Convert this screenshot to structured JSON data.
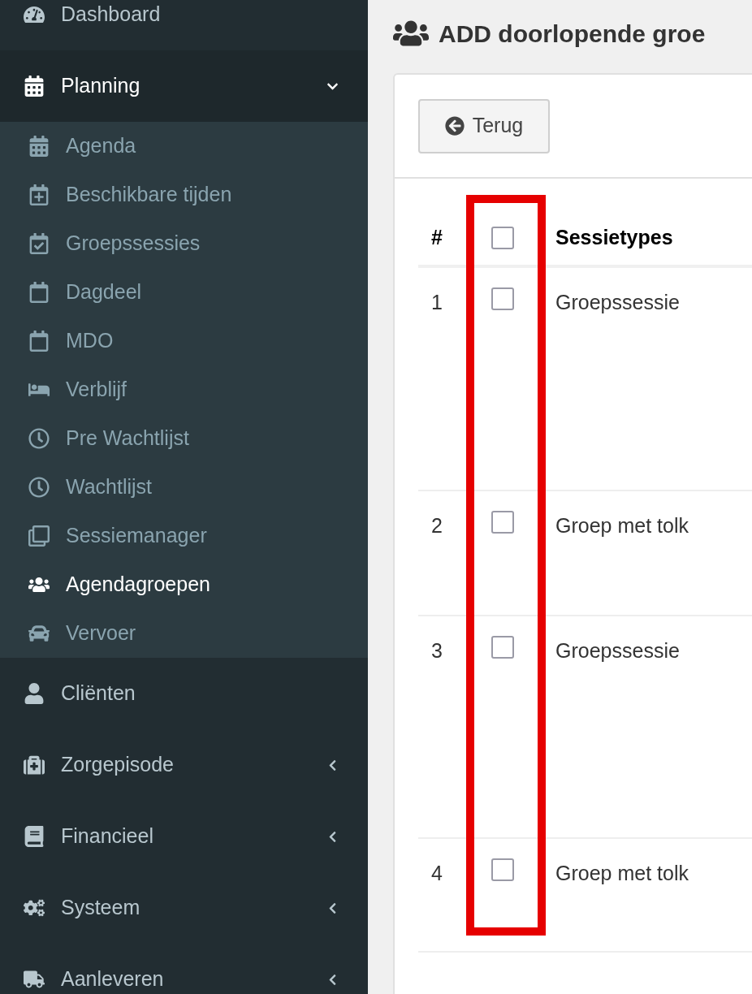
{
  "sidebar": {
    "items": [
      {
        "label": "Dashboard",
        "kind": "link"
      },
      {
        "label": "Planning",
        "kind": "group",
        "expanded": true,
        "children": [
          {
            "label": "Agenda",
            "selected": false
          },
          {
            "label": "Beschikbare tijden",
            "selected": false
          },
          {
            "label": "Groepssessies",
            "selected": false
          },
          {
            "label": "Dagdeel",
            "selected": false
          },
          {
            "label": "MDO",
            "selected": false
          },
          {
            "label": "Verblijf",
            "selected": false
          },
          {
            "label": "Pre Wachtlijst",
            "selected": false
          },
          {
            "label": "Wachtlijst",
            "selected": false
          },
          {
            "label": "Sessiemanager",
            "selected": false
          },
          {
            "label": "Agendagroepen",
            "selected": true
          },
          {
            "label": "Vervoer",
            "selected": false
          }
        ]
      },
      {
        "label": "Cliënten",
        "kind": "link"
      },
      {
        "label": "Zorgepisode",
        "kind": "group",
        "expanded": false
      },
      {
        "label": "Financieel",
        "kind": "group",
        "expanded": false
      },
      {
        "label": "Systeem",
        "kind": "group",
        "expanded": false
      },
      {
        "label": "Aanleveren",
        "kind": "group",
        "expanded": false
      }
    ]
  },
  "page": {
    "title": "ADD doorlopende groe",
    "back_button": "Terug"
  },
  "table": {
    "columns": [
      {
        "label": "#"
      },
      {
        "label": "Sessietypes"
      }
    ],
    "select_all": {
      "checked": false
    },
    "rows": [
      {
        "number": "1",
        "sessietype": "Groepssessie",
        "checked": false
      },
      {
        "number": "2",
        "sessietype": "Groep met tolk",
        "checked": false
      },
      {
        "number": "3",
        "sessietype": "Groepssessie",
        "checked": false
      },
      {
        "number": "4",
        "sessietype": "Groep met tolk",
        "checked": false
      }
    ]
  }
}
